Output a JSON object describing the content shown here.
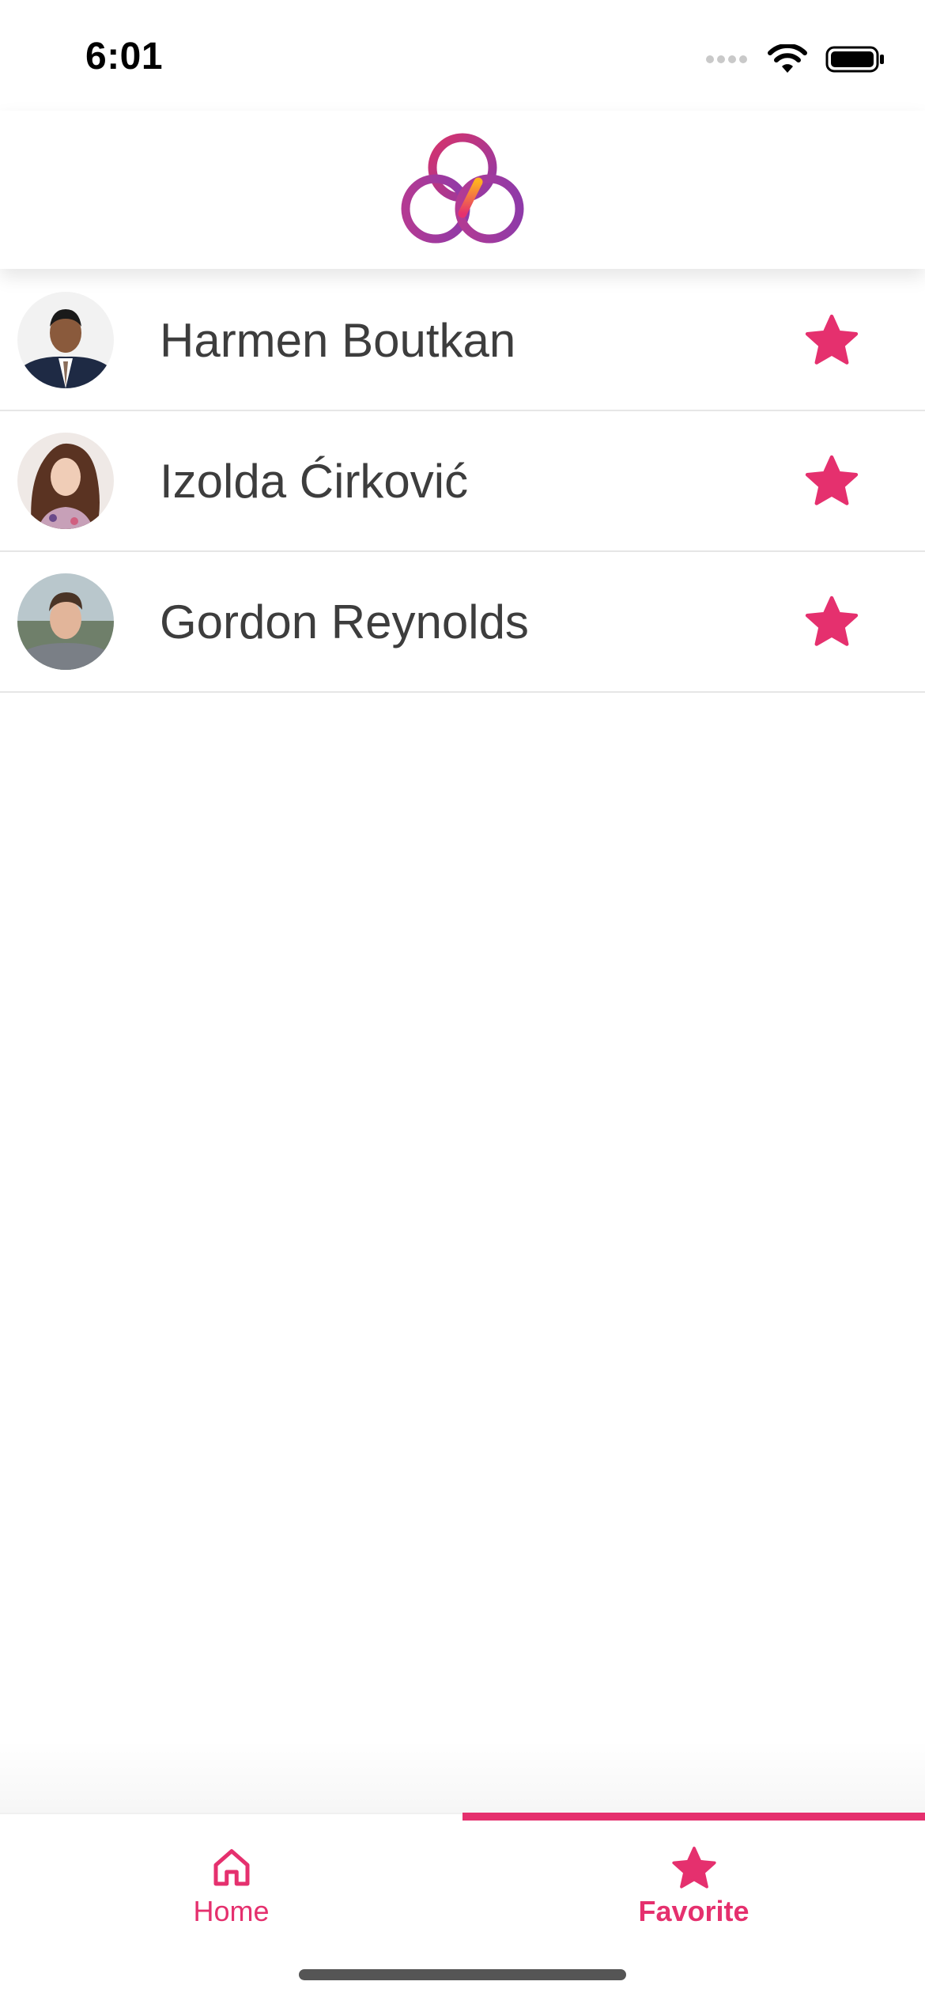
{
  "status_bar": {
    "time": "6:01",
    "icons": [
      "cellular-icon",
      "wifi-icon",
      "battery-icon"
    ]
  },
  "header": {
    "logo_icon": "trefoil-logo-icon"
  },
  "favorites": [
    {
      "name": "Harmen Boutkan",
      "favorited": true
    },
    {
      "name": "Izolda Ćirković",
      "favorited": true
    },
    {
      "name": "Gordon Reynolds",
      "favorited": true
    }
  ],
  "tabs": [
    {
      "label": "Home",
      "icon": "home-icon",
      "active": false
    },
    {
      "label": "Favorite",
      "icon": "star-icon",
      "active": true
    }
  ],
  "colors": {
    "accent": "#e5306e",
    "text": "#3d3d3d"
  }
}
